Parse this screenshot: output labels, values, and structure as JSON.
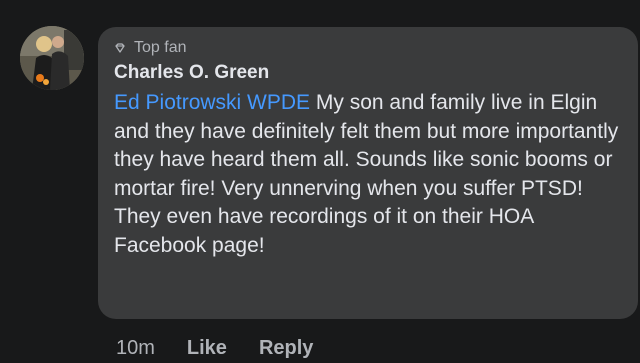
{
  "post": {
    "badge": {
      "label": "Top fan",
      "icon": "diamond-icon"
    },
    "author": "Charles O. Green",
    "mention": "Ed Piotrowski WPDE",
    "body": " My son and family live in Elgin and they have definitely felt them but more importantly they have heard them all. Sounds like sonic booms or mortar fire!  Very unnerving when you suffer PTSD!  They even have recordings of it on their HOA Facebook page!",
    "time": "10m",
    "like_label": "Like",
    "reply_label": "Reply"
  },
  "colors": {
    "background": "#18191a",
    "bubble": "#3a3b3c",
    "text": "#e4e6eb",
    "secondary": "#b0b3b8",
    "mention": "#4599ff"
  }
}
